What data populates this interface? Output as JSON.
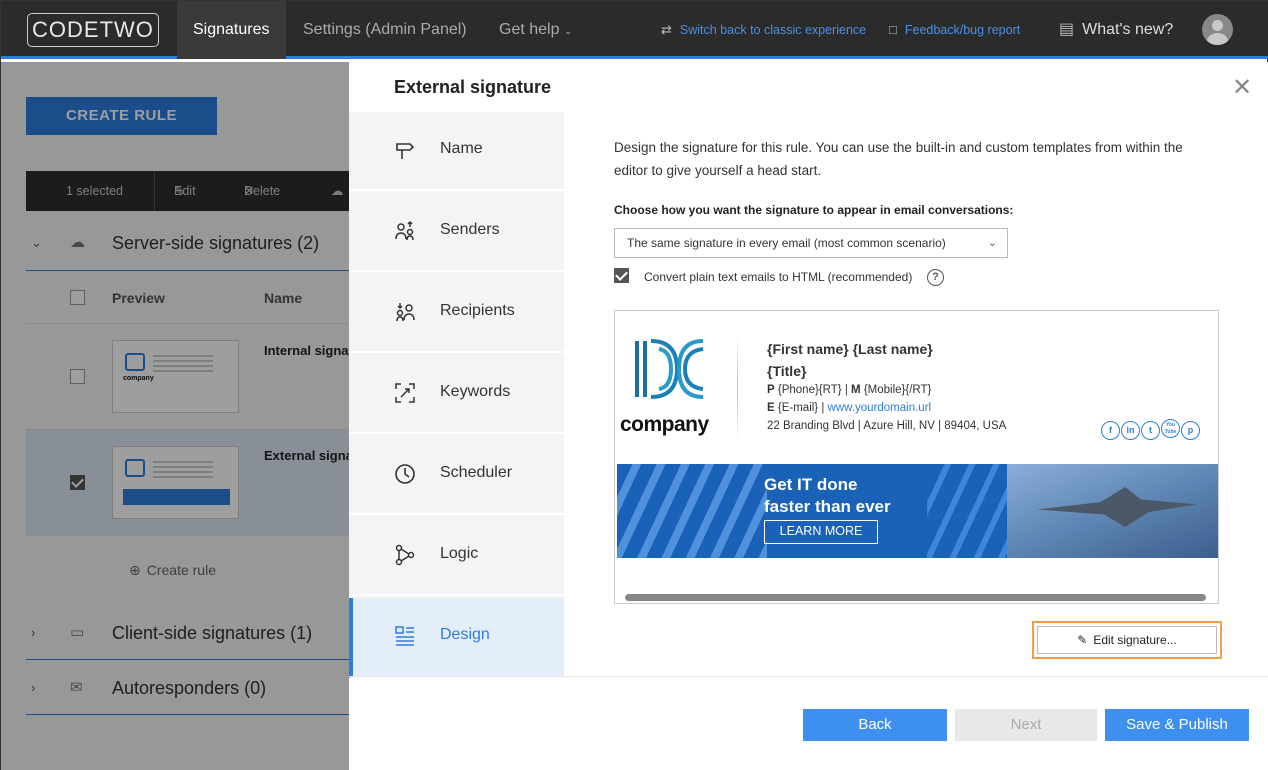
{
  "topbar": {
    "logo": "CODETWO",
    "nav": [
      "Signatures",
      "Settings (Admin Panel)",
      "Get help"
    ],
    "switch_classic": "Switch back to classic experience",
    "feedback": "Feedback/bug report",
    "whats_new": "What's new?"
  },
  "background": {
    "create_rule": "CREATE RULE",
    "toolbar": {
      "selected": "1 selected",
      "edit": "Edit",
      "delete": "Delete"
    },
    "groups": [
      {
        "label": "Server-side signatures (2)"
      },
      {
        "label": "Client-side signatures (1)"
      },
      {
        "label": "Autoresponders (0)"
      }
    ],
    "columns": {
      "preview": "Preview",
      "name": "Name"
    },
    "rows": [
      {
        "name": "Internal signature",
        "checked": false
      },
      {
        "name": "External signature",
        "checked": true
      }
    ],
    "create_rule_small": "Create rule",
    "thumb_company": "company"
  },
  "modal": {
    "title": "External signature",
    "steps": [
      {
        "label": "Name",
        "icon": "signpost-icon"
      },
      {
        "label": "Senders",
        "icon": "senders-icon"
      },
      {
        "label": "Recipients",
        "icon": "recipients-icon"
      },
      {
        "label": "Keywords",
        "icon": "keywords-icon"
      },
      {
        "label": "Scheduler",
        "icon": "clock-icon"
      },
      {
        "label": "Logic",
        "icon": "logic-icon"
      },
      {
        "label": "Design",
        "icon": "design-icon",
        "active": true
      }
    ],
    "description": "Design the signature for this rule. You can use the built-in and custom templates from within the editor to give yourself a head start.",
    "choose_label": "Choose how you want the signature to appear in email conversations:",
    "select_value": "The same signature in every email (most common scenario)",
    "convert_label": "Convert plain text emails to HTML (recommended)",
    "convert_checked": true,
    "signature": {
      "company": "company",
      "name": "{First name} {Last name}",
      "title": "{Title}",
      "phone_p": "P",
      "phone_val": "{Phone}{RT}",
      "phone_m": "M",
      "mobile_val": "{Mobile}{/RT}",
      "email_e": "E",
      "email_val": "{E-mail}",
      "url": "www.yourdomain.url",
      "address": "22 Branding Blvd | Azure Hill, NV | 89404, USA",
      "socials": [
        "f",
        "in",
        "t",
        "You Tube",
        "p"
      ],
      "banner_line1": "Get IT done",
      "banner_line2": "faster than ever",
      "banner_button": "LEARN MORE"
    },
    "edit_signature": "Edit signature...",
    "buttons": {
      "back": "Back",
      "next": "Next",
      "publish": "Save & Publish"
    }
  },
  "colors": {
    "accent": "#2d7de0",
    "highlight": "#f39d4a",
    "topbar": "#2b2b2b"
  }
}
